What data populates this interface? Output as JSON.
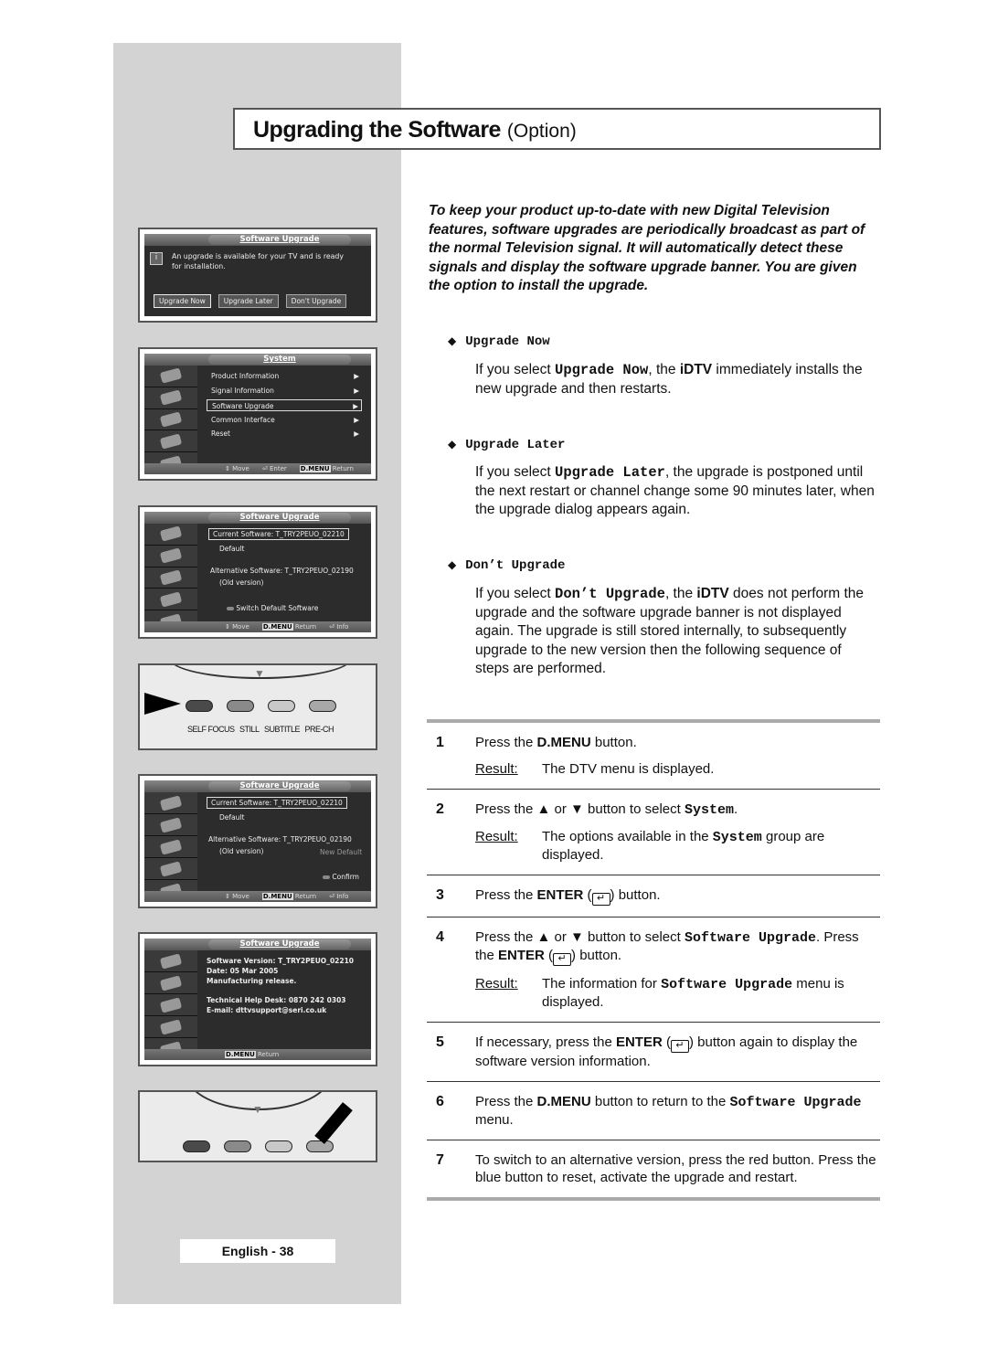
{
  "title": {
    "main": "Upgrading the Software",
    "option": "(Option)"
  },
  "intro": "To keep your product up-to-date with new Digital Television features, software upgrades are periodically broadcast as part of the normal Television signal. It will automatically detect these signals and display the software upgrade banner. You are given the option to install the upgrade.",
  "options": [
    {
      "heading": "Upgrade Now",
      "desc": [
        {
          "t": "If you select "
        },
        {
          "t": "Upgrade Now",
          "s": "m"
        },
        {
          "t": ", the "
        },
        {
          "t": "iDTV",
          "s": "b"
        },
        {
          "t": " immediately installs the new upgrade and then restarts."
        }
      ]
    },
    {
      "heading": "Upgrade Later",
      "desc": [
        {
          "t": "If you select "
        },
        {
          "t": "Upgrade Later",
          "s": "m"
        },
        {
          "t": ", the upgrade is postponed until the next restart or channel change some 90 minutes later, when the upgrade dialog appears again."
        }
      ]
    },
    {
      "heading": "Don’t Upgrade",
      "desc": [
        {
          "t": "If you select "
        },
        {
          "t": "Don’t Upgrade",
          "s": "m"
        },
        {
          "t": ", the "
        },
        {
          "t": "iDTV",
          "s": "b"
        },
        {
          "t": " does not perform the upgrade and the software upgrade banner is not displayed again. The upgrade is still stored internally, to subsequently upgrade to the new version then the following sequence of steps are performed."
        }
      ]
    }
  ],
  "result_label": "Result:",
  "steps": [
    {
      "num": "1",
      "text": [
        {
          "t": "Press the "
        },
        {
          "t": "D.MENU",
          "s": "b"
        },
        {
          "t": " button."
        }
      ],
      "result": [
        {
          "t": "The DTV menu is displayed."
        }
      ]
    },
    {
      "num": "2",
      "text": [
        {
          "t": "Press the ▲ or ▼ button to select "
        },
        {
          "t": "System",
          "s": "m"
        },
        {
          "t": "."
        }
      ],
      "result": [
        {
          "t": "The options available in the "
        },
        {
          "t": "System",
          "s": "m"
        },
        {
          "t": " group are displayed."
        }
      ]
    },
    {
      "num": "3",
      "text": [
        {
          "t": "Press the "
        },
        {
          "t": "ENTER",
          "s": "b"
        },
        {
          "t": " ("
        },
        {
          "t": "↵",
          "s": "e"
        },
        {
          "t": ") button."
        }
      ]
    },
    {
      "num": "4",
      "text": [
        {
          "t": "Press the ▲ or ▼ button to select "
        },
        {
          "t": "Software Upgrade",
          "s": "m"
        },
        {
          "t": ". Press the "
        },
        {
          "t": "ENTER",
          "s": "b"
        },
        {
          "t": " ("
        },
        {
          "t": "↵",
          "s": "e"
        },
        {
          "t": ") button."
        }
      ],
      "result": [
        {
          "t": "The information for "
        },
        {
          "t": "Software Upgrade",
          "s": "m"
        },
        {
          "t": " menu is displayed."
        }
      ]
    },
    {
      "num": "5",
      "text": [
        {
          "t": "If necessary, press the "
        },
        {
          "t": "ENTER",
          "s": "b"
        },
        {
          "t": " ("
        },
        {
          "t": "↵",
          "s": "e"
        },
        {
          "t": ") button again to display the software version information."
        }
      ]
    },
    {
      "num": "6",
      "text": [
        {
          "t": "Press the "
        },
        {
          "t": "D.MENU",
          "s": "b"
        },
        {
          "t": " button to return to the "
        },
        {
          "t": "Software Upgrade",
          "s": "m"
        },
        {
          "t": " menu."
        }
      ]
    },
    {
      "num": "7",
      "text": [
        {
          "t": "To switch to an alternative version, press the red button. Press the blue button to reset, activate the upgrade and restart."
        }
      ]
    }
  ],
  "screens": {
    "banner": {
      "title": "Software Upgrade",
      "message": "An upgrade is available for your TV and is ready for installation.",
      "buttons": [
        "Upgrade Now",
        "Upgrade Later",
        "Don't Upgrade"
      ]
    },
    "system": {
      "title": "System",
      "items": [
        "Product Information",
        "Signal Information",
        "Software Upgrade",
        "Common Interface",
        "Reset"
      ],
      "footer": [
        "Move",
        "Enter",
        "D.MENU",
        "Return"
      ]
    },
    "upgrade1": {
      "title": "Software Upgrade",
      "current": "Current Software: T_TRY2PEUO_02210",
      "default": "Default",
      "alternative": "Alternative Software: T_TRY2PEUO_02190",
      "old": "(Old version)",
      "action": "Switch Default Software",
      "footer": [
        "Move",
        "D.MENU",
        "Return",
        "Info"
      ]
    },
    "upgrade2": {
      "title": "Software Upgrade",
      "current": "Current Software: T_TRY2PEUO_02210",
      "default": "Default",
      "alternative": "Alternative Software: T_TRY2PEUO_02190",
      "old": "(Old version)",
      "new_default": "New Default",
      "action": "Confirm",
      "footer": [
        "Move",
        "D.MENU",
        "Return",
        "Info"
      ]
    },
    "info": {
      "title": "Software Upgrade",
      "lines": [
        "Software Version: T_TRY2PEUO_02210",
        "Date: 05 Mar 2005",
        "Manufacturing release."
      ],
      "help": "Technical Help Desk: 0870 242  0303",
      "email": "E-mail: dttvsupport@seri.co.uk",
      "footer": [
        "D.MENU",
        "Return"
      ]
    }
  },
  "remote": {
    "labels": [
      "SELF FOCUS",
      "STILL",
      "SUBTITLE",
      "PRE-CH"
    ],
    "button_colors": [
      "#4a4a4a",
      "#8a8a8a",
      "#c8c8c8",
      "#a8a8a8"
    ]
  },
  "page_number": "English - 38",
  "colors": {
    "panel": "#d3d3d3",
    "tv_bg": "#2c2c2c"
  }
}
